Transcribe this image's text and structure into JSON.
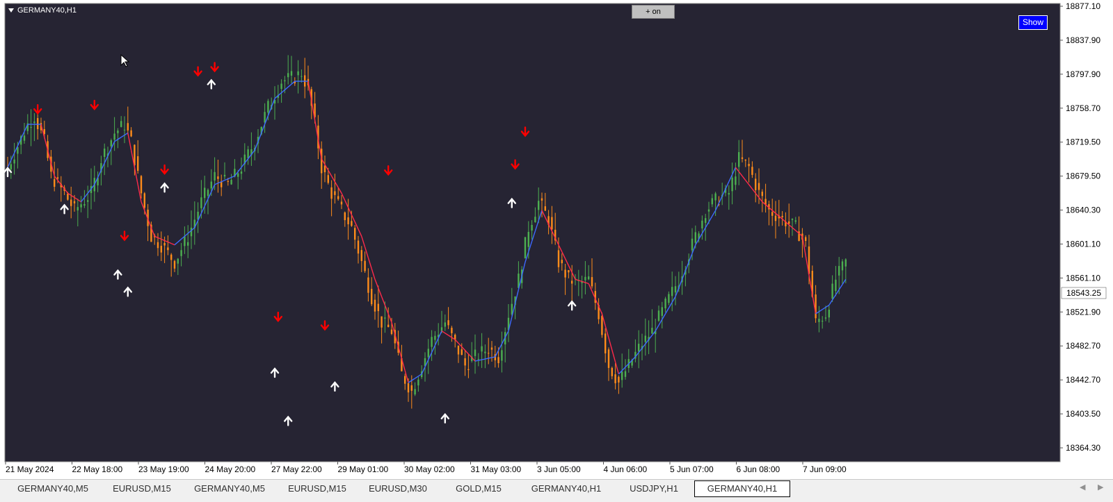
{
  "window": {
    "symbol_title": "GERMANY40,H1",
    "on_button_label": "+ on",
    "show_button_label": "Show",
    "current_price": "18543.25"
  },
  "colors": {
    "background": "#262433",
    "bull_candle": "#4caf50",
    "bear_candle": "#ff8c1a",
    "ma_up": "#3d6bff",
    "ma_down": "#ff2a4a",
    "arrow_down": "#ff0000",
    "arrow_up": "#ffffff"
  },
  "chart_data": {
    "type": "candlestick",
    "y_axis_labels": [
      "18877.10",
      "18837.90",
      "18797.90",
      "18758.70",
      "18719.50",
      "18679.50",
      "18640.30",
      "18601.10",
      "18561.10",
      "18521.90",
      "18482.70",
      "18442.70",
      "18403.50",
      "18364.30"
    ],
    "ylim": [
      18364.3,
      18877.1
    ],
    "x_axis_labels": [
      "21 May 2024",
      "22 May 18:00",
      "23 May 19:00",
      "24 May 20:00",
      "27 May 22:00",
      "29 May 01:00",
      "30 May 02:00",
      "31 May 03:00",
      "3 Jun 05:00",
      "4 Jun 06:00",
      "5 Jun 07:00",
      "6 Jun 08:00",
      "7 Jun 09:00"
    ],
    "bar_count": 170,
    "price_path_keypoints": [
      [
        0,
        18690
      ],
      [
        6,
        18740
      ],
      [
        8,
        18750
      ],
      [
        11,
        18720
      ],
      [
        13,
        18680
      ],
      [
        17,
        18660
      ],
      [
        20,
        18640
      ],
      [
        25,
        18660
      ],
      [
        28,
        18700
      ],
      [
        32,
        18730
      ],
      [
        35,
        18740
      ],
      [
        37,
        18720
      ],
      [
        40,
        18660
      ],
      [
        43,
        18610
      ],
      [
        46,
        18600
      ],
      [
        48,
        18590
      ],
      [
        50,
        18580
      ],
      [
        54,
        18610
      ],
      [
        58,
        18650
      ],
      [
        62,
        18680
      ],
      [
        66,
        18670
      ],
      [
        70,
        18690
      ],
      [
        74,
        18720
      ],
      [
        78,
        18760
      ],
      [
        82,
        18790
      ],
      [
        86,
        18795
      ],
      [
        88,
        18800
      ],
      [
        90,
        18780
      ],
      [
        92,
        18740
      ],
      [
        94,
        18690
      ],
      [
        97,
        18660
      ],
      [
        100,
        18640
      ],
      [
        103,
        18620
      ],
      [
        106,
        18580
      ],
      [
        109,
        18540
      ],
      [
        112,
        18510
      ],
      [
        115,
        18500
      ],
      [
        118,
        18450
      ],
      [
        121,
        18430
      ],
      [
        124,
        18460
      ],
      [
        127,
        18490
      ],
      [
        131,
        18510
      ],
      [
        134,
        18485
      ],
      [
        137,
        18460
      ],
      [
        140,
        18470
      ],
      [
        144,
        18480
      ],
      [
        147,
        18470
      ],
      [
        150,
        18520
      ],
      [
        153,
        18560
      ],
      [
        156,
        18620
      ],
      [
        159,
        18650
      ],
      [
        162,
        18630
      ],
      [
        165,
        18580
      ],
      [
        168,
        18560
      ],
      [
        171,
        18555
      ],
      [
        174,
        18560
      ],
      [
        177,
        18520
      ],
      [
        180,
        18460
      ],
      [
        183,
        18440
      ],
      [
        186,
        18460
      ],
      [
        189,
        18480
      ],
      [
        193,
        18500
      ],
      [
        197,
        18530
      ],
      [
        201,
        18560
      ],
      [
        205,
        18600
      ],
      [
        209,
        18640
      ],
      [
        213,
        18655
      ],
      [
        216,
        18660
      ],
      [
        219,
        18700
      ],
      [
        222,
        18690
      ],
      [
        225,
        18660
      ],
      [
        228,
        18640
      ],
      [
        232,
        18630
      ],
      [
        236,
        18620
      ],
      [
        239,
        18600
      ],
      [
        242,
        18510
      ],
      [
        245,
        18520
      ],
      [
        248,
        18560
      ],
      [
        251,
        18580
      ]
    ],
    "ma_keypoints": [
      [
        0,
        18690
      ],
      [
        6,
        18740
      ],
      [
        10,
        18740
      ],
      [
        14,
        18680
      ],
      [
        18,
        18660
      ],
      [
        22,
        18650
      ],
      [
        26,
        18670
      ],
      [
        32,
        18720
      ],
      [
        36,
        18730
      ],
      [
        40,
        18650
      ],
      [
        44,
        18610
      ],
      [
        50,
        18600
      ],
      [
        56,
        18620
      ],
      [
        62,
        18670
      ],
      [
        68,
        18680
      ],
      [
        74,
        18710
      ],
      [
        80,
        18770
      ],
      [
        86,
        18790
      ],
      [
        90,
        18790
      ],
      [
        94,
        18700
      ],
      [
        100,
        18660
      ],
      [
        106,
        18610
      ],
      [
        110,
        18560
      ],
      [
        115,
        18510
      ],
      [
        120,
        18440
      ],
      [
        124,
        18450
      ],
      [
        130,
        18500
      ],
      [
        134,
        18490
      ],
      [
        140,
        18465
      ],
      [
        146,
        18470
      ],
      [
        150,
        18500
      ],
      [
        155,
        18580
      ],
      [
        160,
        18640
      ],
      [
        165,
        18600
      ],
      [
        170,
        18560
      ],
      [
        174,
        18555
      ],
      [
        178,
        18520
      ],
      [
        183,
        18450
      ],
      [
        188,
        18470
      ],
      [
        194,
        18500
      ],
      [
        200,
        18540
      ],
      [
        206,
        18600
      ],
      [
        212,
        18640
      ],
      [
        218,
        18690
      ],
      [
        222,
        18670
      ],
      [
        226,
        18650
      ],
      [
        232,
        18630
      ],
      [
        238,
        18610
      ],
      [
        242,
        18520
      ],
      [
        246,
        18530
      ],
      [
        251,
        18560
      ]
    ],
    "down_arrows": [
      [
        9,
        18756
      ],
      [
        26,
        18761
      ],
      [
        35,
        18609
      ],
      [
        47,
        18686
      ],
      [
        57,
        18800
      ],
      [
        62,
        18805
      ],
      [
        81,
        18515
      ],
      [
        95,
        18505
      ],
      [
        114,
        18685
      ],
      [
        152,
        18692
      ],
      [
        155,
        18730
      ]
    ],
    "up_arrows": [
      [
        0,
        18686
      ],
      [
        17,
        18643
      ],
      [
        33,
        18567
      ],
      [
        36,
        18547
      ],
      [
        47,
        18668
      ],
      [
        61,
        18788
      ],
      [
        80,
        18453
      ],
      [
        84,
        18397
      ],
      [
        98,
        18437
      ],
      [
        131,
        18400
      ],
      [
        151,
        18650
      ],
      [
        169,
        18531
      ]
    ]
  },
  "tabs": [
    {
      "label": "GERMANY40,M5",
      "active": false
    },
    {
      "label": "EURUSD,M15",
      "active": false
    },
    {
      "label": "GERMANY40,M5",
      "active": false
    },
    {
      "label": "EURUSD,M15",
      "active": false
    },
    {
      "label": "EURUSD,M30",
      "active": false
    },
    {
      "label": "GOLD,M15",
      "active": false
    },
    {
      "label": "GERMANY40,H1",
      "active": false
    },
    {
      "label": "USDJPY,H1",
      "active": false
    },
    {
      "label": "GERMANY40,H1",
      "active": true
    }
  ]
}
